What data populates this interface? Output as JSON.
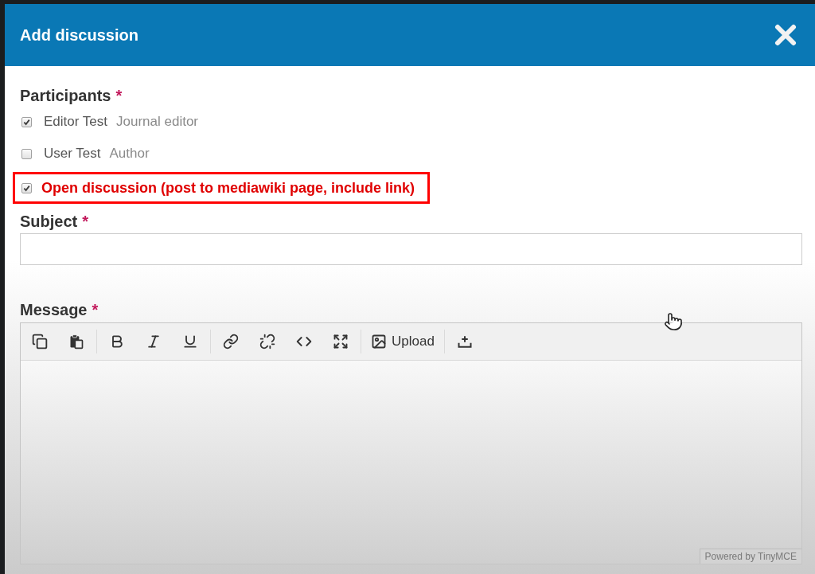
{
  "dialog": {
    "title": "Add discussion"
  },
  "participants": {
    "label": "Participants",
    "required_mark": "*",
    "options": [
      {
        "name": "Editor Test",
        "role": "Journal editor",
        "checked": true
      },
      {
        "name": "User Test",
        "role": "Author",
        "checked": false
      }
    ]
  },
  "open_discussion": {
    "label": "Open discussion (post to mediawiki page, include link)",
    "checked": true,
    "highlighted": true
  },
  "subject": {
    "label": "Subject",
    "required_mark": "*"
  },
  "message": {
    "label": "Message",
    "required_mark": "*",
    "toolbar_groups": [
      {
        "buttons": [
          {
            "kind": "copy"
          },
          {
            "kind": "paste"
          }
        ]
      },
      {
        "buttons": [
          {
            "kind": "bold"
          },
          {
            "kind": "italic"
          },
          {
            "kind": "underline"
          }
        ]
      },
      {
        "buttons": [
          {
            "kind": "link"
          },
          {
            "kind": "unlink"
          },
          {
            "kind": "code"
          },
          {
            "kind": "fullscreen"
          }
        ]
      },
      {
        "buttons": [
          {
            "kind": "image",
            "label": "Upload"
          }
        ]
      },
      {
        "buttons": [
          {
            "kind": "insert"
          }
        ]
      }
    ],
    "branding": "Powered by TinyMCE"
  }
}
